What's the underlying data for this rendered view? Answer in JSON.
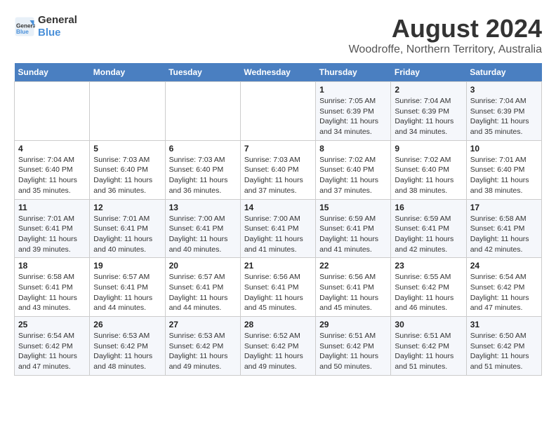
{
  "header": {
    "logo_line1": "General",
    "logo_line2": "Blue",
    "main_title": "August 2024",
    "subtitle": "Woodroffe, Northern Territory, Australia"
  },
  "days_of_week": [
    "Sunday",
    "Monday",
    "Tuesday",
    "Wednesday",
    "Thursday",
    "Friday",
    "Saturday"
  ],
  "weeks": [
    [
      {
        "day": "",
        "info": ""
      },
      {
        "day": "",
        "info": ""
      },
      {
        "day": "",
        "info": ""
      },
      {
        "day": "",
        "info": ""
      },
      {
        "day": "1",
        "info": "Sunrise: 7:05 AM\nSunset: 6:39 PM\nDaylight: 11 hours\nand 34 minutes."
      },
      {
        "day": "2",
        "info": "Sunrise: 7:04 AM\nSunset: 6:39 PM\nDaylight: 11 hours\nand 34 minutes."
      },
      {
        "day": "3",
        "info": "Sunrise: 7:04 AM\nSunset: 6:39 PM\nDaylight: 11 hours\nand 35 minutes."
      }
    ],
    [
      {
        "day": "4",
        "info": "Sunrise: 7:04 AM\nSunset: 6:40 PM\nDaylight: 11 hours\nand 35 minutes."
      },
      {
        "day": "5",
        "info": "Sunrise: 7:03 AM\nSunset: 6:40 PM\nDaylight: 11 hours\nand 36 minutes."
      },
      {
        "day": "6",
        "info": "Sunrise: 7:03 AM\nSunset: 6:40 PM\nDaylight: 11 hours\nand 36 minutes."
      },
      {
        "day": "7",
        "info": "Sunrise: 7:03 AM\nSunset: 6:40 PM\nDaylight: 11 hours\nand 37 minutes."
      },
      {
        "day": "8",
        "info": "Sunrise: 7:02 AM\nSunset: 6:40 PM\nDaylight: 11 hours\nand 37 minutes."
      },
      {
        "day": "9",
        "info": "Sunrise: 7:02 AM\nSunset: 6:40 PM\nDaylight: 11 hours\nand 38 minutes."
      },
      {
        "day": "10",
        "info": "Sunrise: 7:01 AM\nSunset: 6:40 PM\nDaylight: 11 hours\nand 38 minutes."
      }
    ],
    [
      {
        "day": "11",
        "info": "Sunrise: 7:01 AM\nSunset: 6:41 PM\nDaylight: 11 hours\nand 39 minutes."
      },
      {
        "day": "12",
        "info": "Sunrise: 7:01 AM\nSunset: 6:41 PM\nDaylight: 11 hours\nand 40 minutes."
      },
      {
        "day": "13",
        "info": "Sunrise: 7:00 AM\nSunset: 6:41 PM\nDaylight: 11 hours\nand 40 minutes."
      },
      {
        "day": "14",
        "info": "Sunrise: 7:00 AM\nSunset: 6:41 PM\nDaylight: 11 hours\nand 41 minutes."
      },
      {
        "day": "15",
        "info": "Sunrise: 6:59 AM\nSunset: 6:41 PM\nDaylight: 11 hours\nand 41 minutes."
      },
      {
        "day": "16",
        "info": "Sunrise: 6:59 AM\nSunset: 6:41 PM\nDaylight: 11 hours\nand 42 minutes."
      },
      {
        "day": "17",
        "info": "Sunrise: 6:58 AM\nSunset: 6:41 PM\nDaylight: 11 hours\nand 42 minutes."
      }
    ],
    [
      {
        "day": "18",
        "info": "Sunrise: 6:58 AM\nSunset: 6:41 PM\nDaylight: 11 hours\nand 43 minutes."
      },
      {
        "day": "19",
        "info": "Sunrise: 6:57 AM\nSunset: 6:41 PM\nDaylight: 11 hours\nand 44 minutes."
      },
      {
        "day": "20",
        "info": "Sunrise: 6:57 AM\nSunset: 6:41 PM\nDaylight: 11 hours\nand 44 minutes."
      },
      {
        "day": "21",
        "info": "Sunrise: 6:56 AM\nSunset: 6:41 PM\nDaylight: 11 hours\nand 45 minutes."
      },
      {
        "day": "22",
        "info": "Sunrise: 6:56 AM\nSunset: 6:41 PM\nDaylight: 11 hours\nand 45 minutes."
      },
      {
        "day": "23",
        "info": "Sunrise: 6:55 AM\nSunset: 6:42 PM\nDaylight: 11 hours\nand 46 minutes."
      },
      {
        "day": "24",
        "info": "Sunrise: 6:54 AM\nSunset: 6:42 PM\nDaylight: 11 hours\nand 47 minutes."
      }
    ],
    [
      {
        "day": "25",
        "info": "Sunrise: 6:54 AM\nSunset: 6:42 PM\nDaylight: 11 hours\nand 47 minutes."
      },
      {
        "day": "26",
        "info": "Sunrise: 6:53 AM\nSunset: 6:42 PM\nDaylight: 11 hours\nand 48 minutes."
      },
      {
        "day": "27",
        "info": "Sunrise: 6:53 AM\nSunset: 6:42 PM\nDaylight: 11 hours\nand 49 minutes."
      },
      {
        "day": "28",
        "info": "Sunrise: 6:52 AM\nSunset: 6:42 PM\nDaylight: 11 hours\nand 49 minutes."
      },
      {
        "day": "29",
        "info": "Sunrise: 6:51 AM\nSunset: 6:42 PM\nDaylight: 11 hours\nand 50 minutes."
      },
      {
        "day": "30",
        "info": "Sunrise: 6:51 AM\nSunset: 6:42 PM\nDaylight: 11 hours\nand 51 minutes."
      },
      {
        "day": "31",
        "info": "Sunrise: 6:50 AM\nSunset: 6:42 PM\nDaylight: 11 hours\nand 51 minutes."
      }
    ]
  ]
}
